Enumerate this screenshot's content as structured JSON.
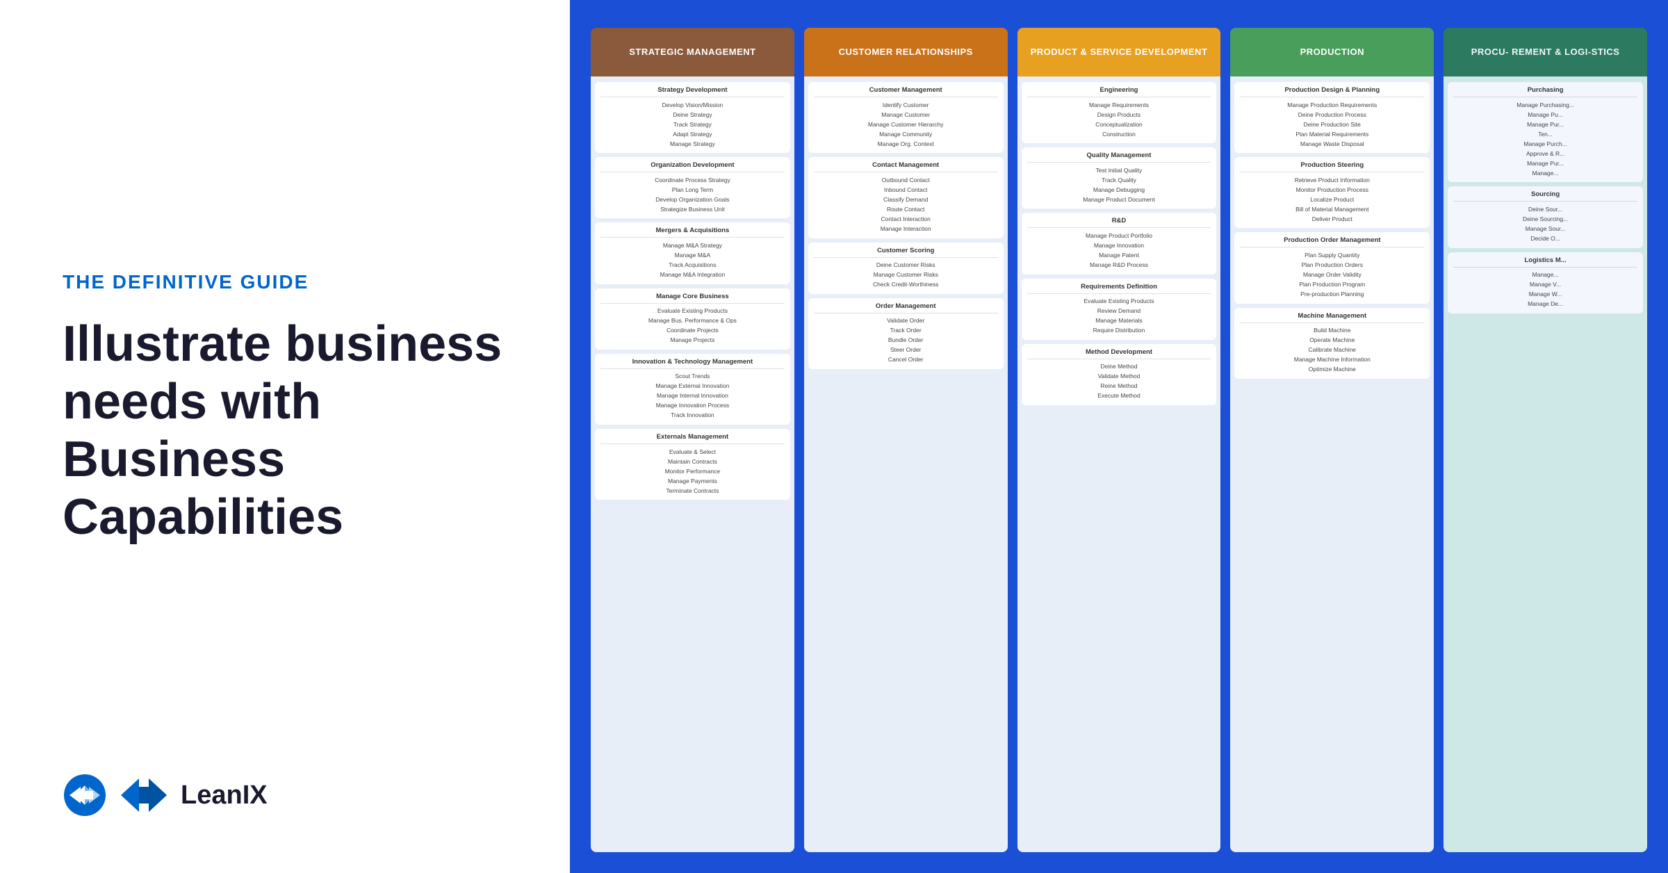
{
  "left": {
    "guide_label": "THE DEFINITIVE GUIDE",
    "heading": "Illustrate business needs with Business Capabilities",
    "logo_text": "LeanIX"
  },
  "columns": [
    {
      "id": "strategic",
      "header": "STRATEGIC MANAGEMENT",
      "colorClass": "col-strategic",
      "groups": [
        {
          "title": "Strategy Development",
          "items": [
            "Develop Vision/Mission",
            "Deine Strategy",
            "Track Strategy",
            "Adapt Strategy",
            "Manage Strategy"
          ]
        },
        {
          "title": "Organization Development",
          "items": [
            "Coordinate Process Strategy",
            "Plan Long Term",
            "Develop Organization Goals",
            "Strategize Business Unit"
          ]
        },
        {
          "title": "Mergers & Acquisitions",
          "items": [
            "Manage M&A Strategy",
            "Manage M&A",
            "Track Acquisitions",
            "Manage M&A Integration"
          ]
        },
        {
          "title": "Manage Core Business",
          "items": [
            "Evaluate Existing Products",
            "Manage Bus. Performance & Ops",
            "Coordinate Projects",
            "Manage Projects"
          ]
        },
        {
          "title": "Innovation & Technology Management",
          "items": [
            "Scout Trends",
            "Manage External Innovation",
            "Manage Internal Innovation",
            "Manage Innovation Process",
            "Track Innovation"
          ]
        },
        {
          "title": "Externals Management",
          "items": [
            "Evaluate & Select",
            "Maintain Contracts",
            "Monitor Performance",
            "Manage Payments",
            "Terminate Contracts"
          ]
        }
      ]
    },
    {
      "id": "customer",
      "header": "CUSTOMER RELATIONSHIPS",
      "colorClass": "col-customer",
      "groups": [
        {
          "title": "Customer Management",
          "items": [
            "Identify Customer",
            "Manage Customer",
            "Manage Customer Hierarchy",
            "Manage Community",
            "Manage Org. Context"
          ]
        },
        {
          "title": "Contact Management",
          "items": [
            "Outbound Contact",
            "Inbound Contact",
            "Classify Demand",
            "Route Contact",
            "Contact Interaction",
            "Manage Interaction"
          ]
        },
        {
          "title": "Customer Scoring",
          "items": [
            "Deine Customer Risks",
            "Manage Customer Risks",
            "Check Credit-Worthiness"
          ]
        },
        {
          "title": "Order Management",
          "items": [
            "Validate Order",
            "Track Order",
            "Bundle Order",
            "Steer Order",
            "Cancel Order"
          ]
        }
      ]
    },
    {
      "id": "product",
      "header": "PRODUCT & SERVICE DEVELOPMENT",
      "colorClass": "col-product",
      "groups": [
        {
          "title": "Engineering",
          "items": [
            "Manage Requirements",
            "Design Products",
            "Conceptualization",
            "Construction"
          ]
        },
        {
          "title": "Quality Management",
          "items": [
            "Test Initial Quality",
            "Track Quality",
            "Manage Debugging",
            "Manage Product Document"
          ]
        },
        {
          "title": "R&D",
          "items": [
            "Manage Product Portfolio",
            "Manage Innovation",
            "Manage Patent",
            "Manage R&D Process"
          ]
        },
        {
          "title": "Requirements Definition",
          "items": [
            "Evaluate Existing Products",
            "Review Demand",
            "Manage Materials",
            "Require Distribution"
          ]
        },
        {
          "title": "Method Development",
          "items": [
            "Deine Method",
            "Validate Method",
            "Reine Method",
            "Execute Method"
          ]
        }
      ]
    },
    {
      "id": "production",
      "header": "PRODUCTION",
      "colorClass": "col-production",
      "groups": [
        {
          "title": "Production Design & Planning",
          "items": [
            "Manage Production Requirements",
            "Deine Production Process",
            "Deine Production Site",
            "Plan Material Requirements",
            "Manage Waste Disposal"
          ]
        },
        {
          "title": "Production Steering",
          "items": [
            "Retrieve Product Information",
            "Monitor Production Process",
            "Localize Product",
            "Bill of Material Management",
            "Deliver Product"
          ]
        },
        {
          "title": "Production Order Management",
          "items": [
            "Plan Supply Quantity",
            "Plan Production Orders",
            "Manage Order Validity",
            "Plan Production Program",
            "Pre-production Planning"
          ]
        },
        {
          "title": "Machine Management",
          "items": [
            "Build Machine",
            "Operate Machine",
            "Calibrate Machine",
            "Manage Machine Information",
            "Optimize Machine"
          ]
        }
      ]
    },
    {
      "id": "procurement",
      "header": "PROCU- REMENT & LOGI-STICS",
      "colorClass": "col-procurement",
      "groups": [
        {
          "title": "Purchasing",
          "items": [
            "Manage Purchasing...",
            "Manage Pu...",
            "Manage Pur...",
            "Ten...",
            "Manage Purch...",
            "Approve & R...",
            "Manage Pur...",
            "Manage..."
          ]
        },
        {
          "title": "Sourcing",
          "items": [
            "Deine Sour...",
            "Deine Sourcing...",
            "Manage Sour...",
            "Decide O..."
          ]
        },
        {
          "title": "Logistics M...",
          "items": [
            "Manage...",
            "Manage V...",
            "Manage W...",
            "Manage De..."
          ]
        }
      ]
    }
  ]
}
